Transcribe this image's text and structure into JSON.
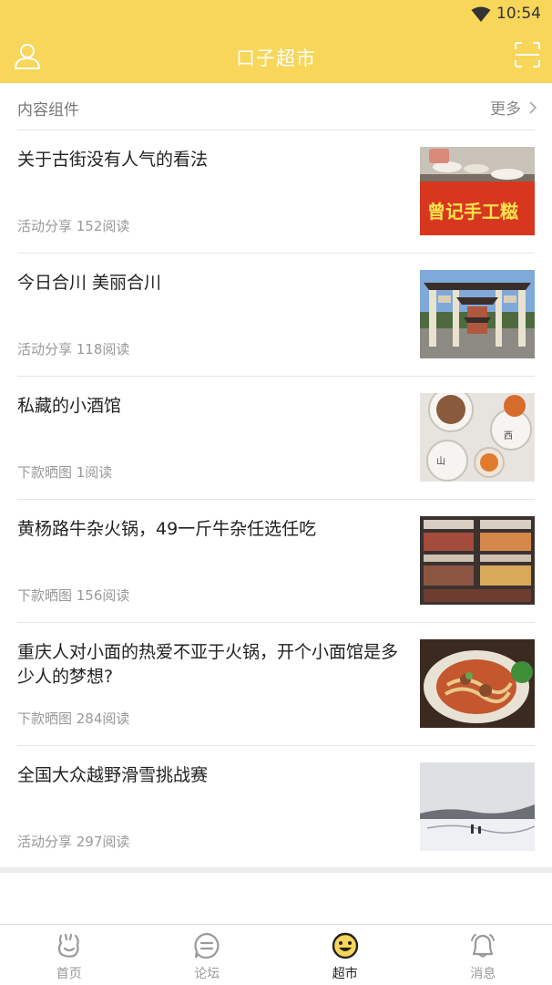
{
  "status": {
    "time": "10:54"
  },
  "header": {
    "title": "口子超市"
  },
  "section": {
    "title": "内容组件",
    "more_label": "更多"
  },
  "items": [
    {
      "title": "关于古街没有人气的看法",
      "meta": "活动分享 152阅读",
      "thumb": "street-food-stall",
      "thumb_text": "曾记手工糍"
    },
    {
      "title": "今日合川 美丽合川",
      "meta": "活动分享 118阅读",
      "thumb": "memorial-archway"
    },
    {
      "title": "私藏的小酒馆",
      "meta": "下款晒图 1阅读",
      "thumb": "bowls-table"
    },
    {
      "title": "黄杨路牛杂火锅，49一斤牛杂任选任吃",
      "meta": "下款晒图 156阅读",
      "thumb": "meat-display-case"
    },
    {
      "title": "重庆人对小面的热爱不亚于火锅，开个小面馆是多少人的梦想?",
      "meta": "下款晒图 284阅读",
      "thumb": "noodle-plate"
    },
    {
      "title": "全国大众越野滑雪挑战赛",
      "meta": "活动分享 297阅读",
      "thumb": "snow-landscape"
    }
  ],
  "tabs": [
    {
      "label": "首页",
      "icon": "home-icon",
      "active": false
    },
    {
      "label": "论坛",
      "icon": "forum-icon",
      "active": false
    },
    {
      "label": "超市",
      "icon": "market-icon",
      "active": true
    },
    {
      "label": "消息",
      "icon": "bell-icon",
      "active": false
    }
  ],
  "colors": {
    "brand_yellow": "#f7d65a",
    "text_dark": "#222222",
    "text_gray": "#999999"
  }
}
